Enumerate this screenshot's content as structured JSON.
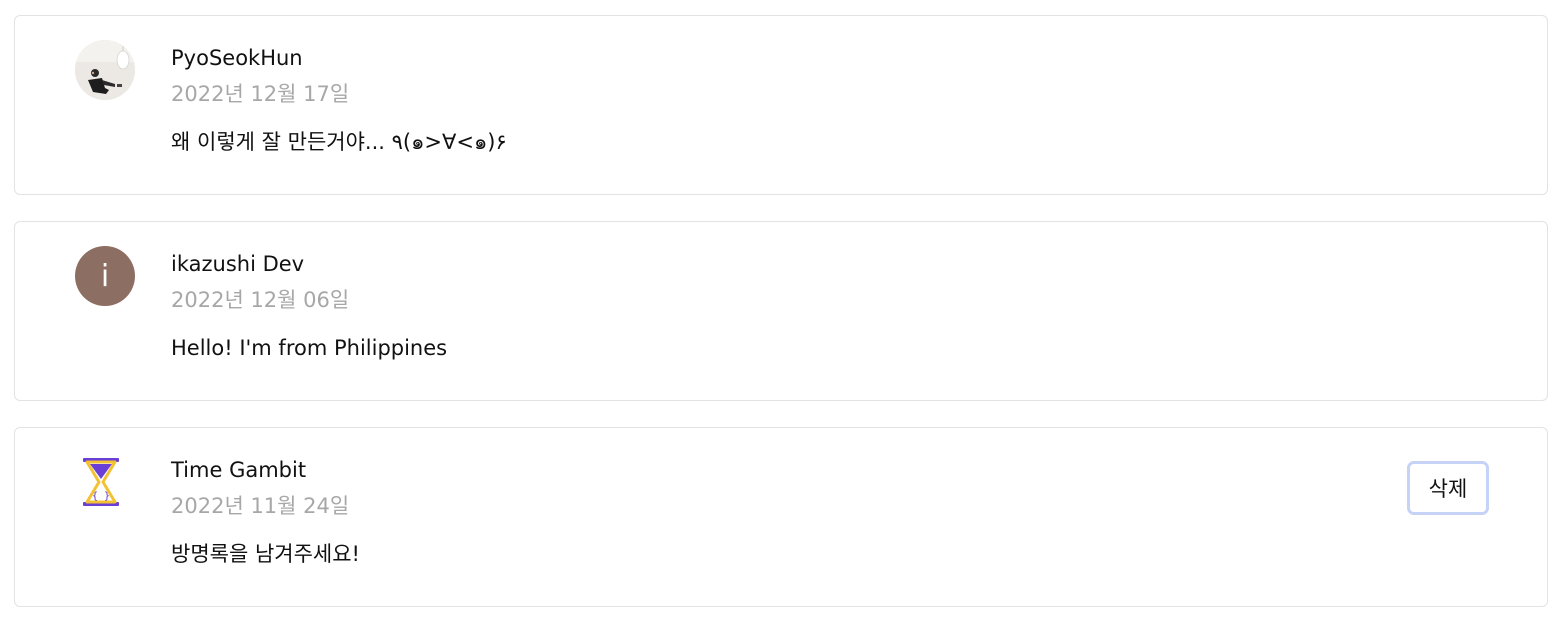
{
  "entries": [
    {
      "author": "PyoSeokHun",
      "date": "2022년 12월 17일",
      "message": "왜 이렇게 잘 만든거야... ٩(๑>∀<๑)۶",
      "avatar": {
        "type": "photo",
        "icon": "user-photo-icon"
      }
    },
    {
      "author": "ikazushi Dev",
      "date": "2022년 12월 06일",
      "message": "Hello! I'm from Philippines",
      "avatar": {
        "type": "letter",
        "letter": "i",
        "color": "#8d6e63"
      }
    },
    {
      "author": "Time Gambit",
      "date": "2022년 11월 24일",
      "message": "방명록을 남겨주세요!",
      "avatar": {
        "type": "logo",
        "icon": "hourglass-icon",
        "colors": {
          "frame": "#6a3fd6",
          "sand": "#f2c233"
        }
      },
      "delete_label": "삭제"
    }
  ],
  "colors": {
    "border": "#e3e3e3",
    "date_text": "#a7a7a7",
    "delete_border": "#c7d2f7"
  }
}
